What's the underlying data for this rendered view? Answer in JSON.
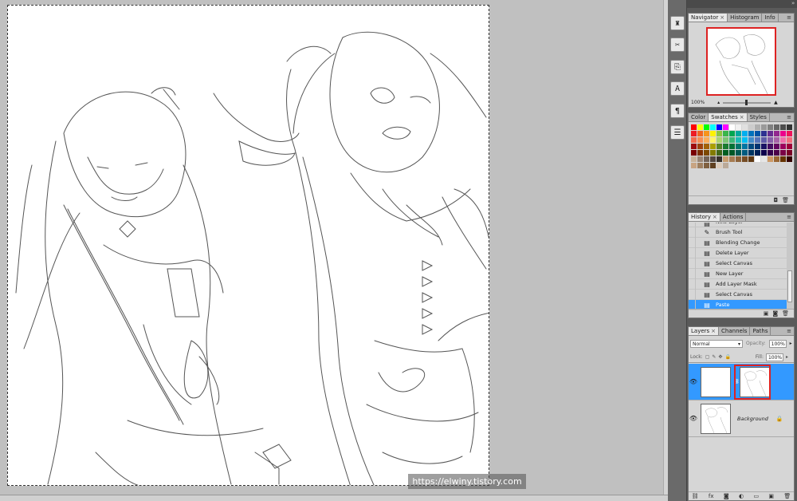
{
  "watermark": "https://elwiny.tistory.com",
  "toolstrip": [
    "tool-preset-icon",
    "brush-tool-icon",
    "clone-source-icon",
    "character-icon",
    "paragraph-icon",
    "notes-icon"
  ],
  "navigator": {
    "tabs": [
      "Navigator",
      "Histogram",
      "Info"
    ],
    "zoom": "100%"
  },
  "swatches": {
    "tabs": [
      "Color",
      "Swatches",
      "Styles"
    ],
    "colors": [
      "#ff0000",
      "#ffff00",
      "#00ff00",
      "#00ffff",
      "#0000ff",
      "#ff00ff",
      "#ffffff",
      "#f0f0f0",
      "#e0e0e0",
      "#cccccc",
      "#b0b0b0",
      "#999999",
      "#808080",
      "#666666",
      "#4d4d4d",
      "#333333",
      "#ed1c24",
      "#f26522",
      "#f7941d",
      "#fff200",
      "#8dc63f",
      "#39b54a",
      "#00a651",
      "#00a99d",
      "#00aeef",
      "#0072bc",
      "#0054a6",
      "#2e3192",
      "#662d91",
      "#92278f",
      "#ec008c",
      "#ed145b",
      "#f26c4f",
      "#f68e55",
      "#fbaf5c",
      "#fff467",
      "#acd372",
      "#7cc576",
      "#3bb878",
      "#1abbb4",
      "#00bff3",
      "#438cca",
      "#5574b9",
      "#605ca8",
      "#855fa8",
      "#a763a8",
      "#f06eaa",
      "#f26d7d",
      "#9e0b0f",
      "#a0410d",
      "#a36209",
      "#aba000",
      "#598527",
      "#1a7b30",
      "#007236",
      "#00746b",
      "#0076a3",
      "#004a80",
      "#003471",
      "#1b1464",
      "#440e62",
      "#630460",
      "#9e005d",
      "#9e0039",
      "#790000",
      "#7b2e00",
      "#7d4900",
      "#827b00",
      "#406618",
      "#005e20",
      "#005826",
      "#005952",
      "#005b7f",
      "#003663",
      "#002157",
      "#0d004c",
      "#32004b",
      "#4b0049",
      "#7b0046",
      "#7a0026",
      "#c7b299",
      "#998675",
      "#736357",
      "#534741",
      "#37302a",
      "#c69c6d",
      "#a67c52",
      "#8c6239",
      "#754c24",
      "#603913",
      "#ffffff",
      "#e6e6e6",
      "#cc9966",
      "#996633",
      "#663300",
      "#330000",
      "#c8a482",
      "#a08060",
      "#806040",
      "#604020",
      "#ddccbb",
      "#bbaa99"
    ]
  },
  "history": {
    "tabs": [
      "History",
      "Actions"
    ],
    "items": [
      {
        "label": "New Layer",
        "icon": "layer-icon"
      },
      {
        "label": "Brush Tool",
        "icon": "brush-icon"
      },
      {
        "label": "Blending Change",
        "icon": "layer-icon"
      },
      {
        "label": "Delete Layer",
        "icon": "layer-icon"
      },
      {
        "label": "Select Canvas",
        "icon": "layer-icon"
      },
      {
        "label": "New Layer",
        "icon": "layer-icon"
      },
      {
        "label": "Add Layer Mask",
        "icon": "layer-icon"
      },
      {
        "label": "Select Canvas",
        "icon": "layer-icon"
      },
      {
        "label": "Paste",
        "icon": "layer-icon",
        "selected": true
      }
    ]
  },
  "layers": {
    "tabs": [
      "Layers",
      "Channels",
      "Paths"
    ],
    "blend_mode": "Normal",
    "opacity_label": "Opacity:",
    "opacity": "100%",
    "lock_label": "Lock:",
    "fill_label": "Fill:",
    "fill": "100%",
    "items": [
      {
        "name": "",
        "selected": true
      },
      {
        "name": "Background",
        "locked": true
      }
    ]
  }
}
